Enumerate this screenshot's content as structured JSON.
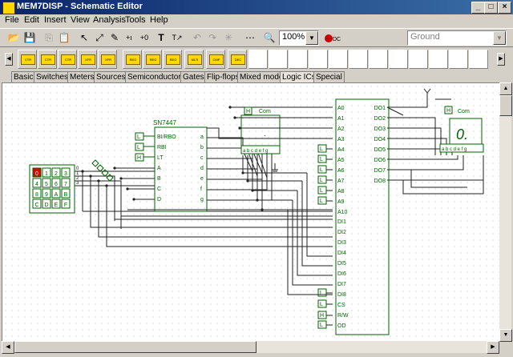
{
  "window": {
    "title": "MEM7DISP - Schematic Editor"
  },
  "menu": [
    "File",
    "Edit",
    "Insert",
    "View",
    "Analysis",
    "Tools",
    "Help"
  ],
  "toolbar": {
    "zoom": "100%",
    "ground_combo": "Ground",
    "dc_label": "DC"
  },
  "parts_bar": [
    "CTR",
    "CTR",
    "CTR",
    "XFR",
    "XFR",
    "REG",
    "REG",
    "REG",
    "MLTI",
    "CMP",
    "DEC"
  ],
  "tabs": [
    "Basic",
    "Switches",
    "Meters",
    "Sources",
    "Semiconductors",
    "Gates",
    "Flip-flops",
    "Mixed mode",
    "Logic ICs",
    "Special"
  ],
  "active_tab": "Logic ICs",
  "schematic": {
    "keypad": [
      "0",
      "1",
      "2",
      "3",
      "4",
      "5",
      "6",
      "7",
      "8",
      "9",
      "A",
      "B",
      "C",
      "D",
      "E",
      "F"
    ],
    "keypad_outputs": [
      "0",
      "1",
      "2",
      "3"
    ],
    "decoder": {
      "name": "SN7447",
      "inputs": [
        "BI/RBO",
        "RBI",
        "LT",
        "A",
        "B",
        "C",
        "D"
      ],
      "input_levels": [
        "L",
        "L",
        "H"
      ],
      "outputs": [
        "a",
        "b",
        "c",
        "d",
        "e",
        "f",
        "g"
      ]
    },
    "display_left": {
      "com_level": "H",
      "com_label": "Com",
      "segments": "a b c d e f g",
      "digit": "."
    },
    "display_right": {
      "com_level": "H",
      "com_label": "Com",
      "segments": "a b c d e f g",
      "digit": "0."
    },
    "memory": {
      "address_pins": [
        "A0",
        "A1",
        "A2",
        "A3",
        "A4",
        "A5",
        "A6",
        "A7",
        "A8",
        "A9",
        "A10"
      ],
      "data_in_pins": [
        "DI1",
        "DI2",
        "DI3",
        "DI4",
        "DI5",
        "DI6",
        "DI7",
        "DI8"
      ],
      "control_pins": [
        "CS",
        "R/W",
        "OD"
      ],
      "control_levels": [
        "L",
        "L",
        "H",
        "L"
      ],
      "address_levels": [
        "L",
        "L",
        "L",
        "L",
        "L",
        "L"
      ],
      "data_out_pins": [
        "DO1",
        "DO2",
        "DO3",
        "DO4",
        "DO5",
        "DO6",
        "DO7",
        "DO8"
      ]
    },
    "wire_color": "#202020",
    "component_color": "#006000",
    "highlight_color": "#e00000"
  }
}
